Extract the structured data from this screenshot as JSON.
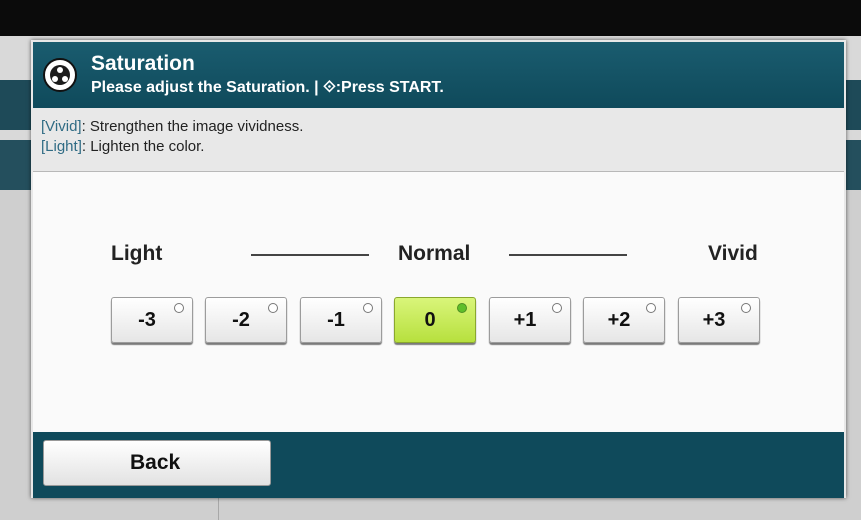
{
  "dialog": {
    "title": "Saturation",
    "subtitle": "Please adjust the Saturation. | ⟐:Press START.",
    "icon": "color-wheel-icon"
  },
  "description": {
    "line1_tag": "[Vivid]",
    "line1_text": ": Strengthen the image vividness.",
    "line2_tag": "[Light]",
    "line2_text": ": Lighten the color."
  },
  "scale": {
    "light_label": "Light",
    "normal_label": "Normal",
    "vivid_label": "Vivid",
    "options": [
      "-3",
      "-2",
      "-1",
      "0",
      "+1",
      "+2",
      "+3"
    ],
    "selected": "0"
  },
  "footer": {
    "back_label": "Back"
  },
  "colors": {
    "header": "#0f4a5b",
    "selected": "#c6eb52",
    "tag": "#2f6b84"
  }
}
